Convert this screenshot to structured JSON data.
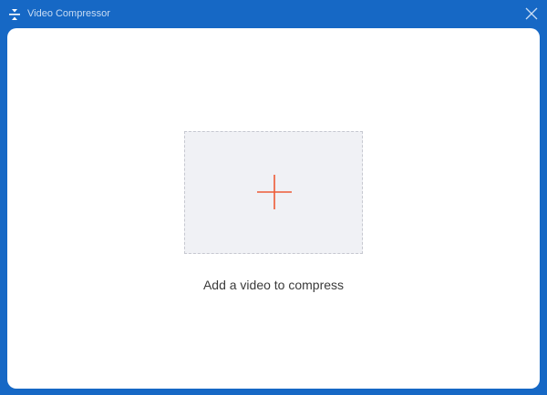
{
  "window": {
    "title": "Video Compressor",
    "app_icon": "compress-icon",
    "close_icon": "close-icon"
  },
  "dropzone": {
    "icon": "plus-icon",
    "hint": "Add a video to compress"
  },
  "colors": {
    "frame": "#1668c5",
    "title_text": "#c9ddf4",
    "dropzone_bg": "#f0f1f5",
    "plus_accent": "#ee5a36"
  }
}
